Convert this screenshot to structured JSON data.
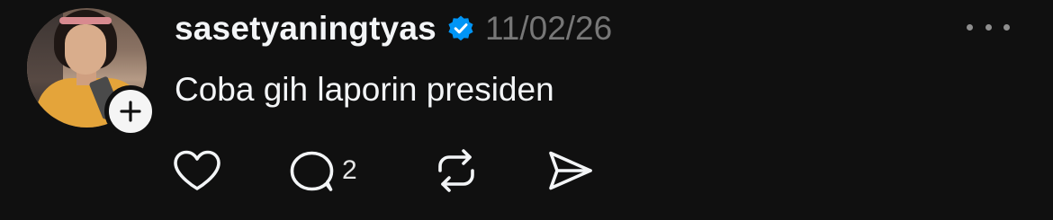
{
  "post": {
    "username": "sasetyaningtyas",
    "verified": true,
    "timestamp": "11/02/26",
    "text": "Coba gih laporin presiden",
    "reply_count": "2"
  },
  "icons": {
    "verified": "verified-badge-icon",
    "follow": "plus-icon",
    "more": "more-horizontal-icon",
    "like": "heart-icon",
    "reply": "comment-icon",
    "repost": "repost-icon",
    "share": "send-icon"
  },
  "colors": {
    "background": "#101010",
    "primary_text": "#f3f5f7",
    "secondary_text": "#777777",
    "verified_blue": "#0095f6"
  }
}
